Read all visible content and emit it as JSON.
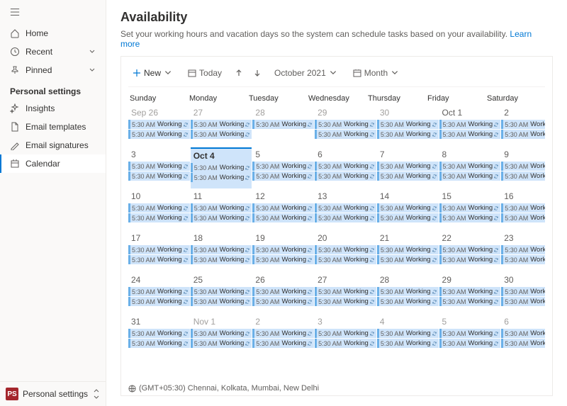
{
  "sidebar": {
    "items": [
      {
        "icon": "home",
        "label": "Home"
      },
      {
        "icon": "clock",
        "label": "Recent",
        "expandable": true
      },
      {
        "icon": "pin",
        "label": "Pinned",
        "expandable": true
      }
    ],
    "section": "Personal settings",
    "settings": [
      {
        "icon": "insights",
        "label": "Insights"
      },
      {
        "icon": "doc",
        "label": "Email templates"
      },
      {
        "icon": "sig",
        "label": "Email signatures"
      },
      {
        "icon": "cal",
        "label": "Calendar",
        "selected": true
      }
    ],
    "footer": {
      "badge": "PS",
      "label": "Personal settings"
    }
  },
  "header": {
    "title": "Availability",
    "desc": "Set your working hours and vacation days so the system can schedule tasks based on your availability.",
    "link": "Learn more"
  },
  "toolbar": {
    "new": "New",
    "today": "Today",
    "period": "October 2021",
    "view": "Month"
  },
  "dayHeaders": [
    "Sunday",
    "Monday",
    "Tuesday",
    "Wednesday",
    "Thursday",
    "Friday",
    "Saturday"
  ],
  "event": {
    "time": "5:30 AM",
    "label": "Working"
  },
  "weeks": [
    [
      {
        "d": "Sep 26",
        "o": true,
        "e": 2
      },
      {
        "d": "27",
        "o": true,
        "e": 2
      },
      {
        "d": "28",
        "o": true,
        "e": 1
      },
      {
        "d": "29",
        "o": true,
        "e": 2
      },
      {
        "d": "30",
        "o": true,
        "e": 2
      },
      {
        "d": "Oct 1",
        "e": 2
      },
      {
        "d": "2",
        "e": 2
      }
    ],
    [
      {
        "d": "3",
        "e": 2
      },
      {
        "d": "Oct 4",
        "today": true,
        "e": 2
      },
      {
        "d": "5",
        "e": 2
      },
      {
        "d": "6",
        "e": 2
      },
      {
        "d": "7",
        "e": 2
      },
      {
        "d": "8",
        "e": 2
      },
      {
        "d": "9",
        "e": 2
      }
    ],
    [
      {
        "d": "10",
        "e": 2
      },
      {
        "d": "11",
        "e": 2
      },
      {
        "d": "12",
        "e": 2
      },
      {
        "d": "13",
        "e": 2
      },
      {
        "d": "14",
        "e": 2
      },
      {
        "d": "15",
        "e": 2
      },
      {
        "d": "16",
        "e": 2
      }
    ],
    [
      {
        "d": "17",
        "e": 2
      },
      {
        "d": "18",
        "e": 2
      },
      {
        "d": "19",
        "e": 2
      },
      {
        "d": "20",
        "e": 2
      },
      {
        "d": "21",
        "e": 2
      },
      {
        "d": "22",
        "e": 2
      },
      {
        "d": "23",
        "e": 2
      }
    ],
    [
      {
        "d": "24",
        "e": 2
      },
      {
        "d": "25",
        "e": 2
      },
      {
        "d": "26",
        "e": 2
      },
      {
        "d": "27",
        "e": 2
      },
      {
        "d": "28",
        "e": 2
      },
      {
        "d": "29",
        "e": 2
      },
      {
        "d": "30",
        "e": 2
      }
    ],
    [
      {
        "d": "31",
        "e": 2
      },
      {
        "d": "Nov 1",
        "o": true,
        "e": 2
      },
      {
        "d": "2",
        "o": true,
        "e": 2
      },
      {
        "d": "3",
        "o": true,
        "e": 2
      },
      {
        "d": "4",
        "o": true,
        "e": 2
      },
      {
        "d": "5",
        "o": true,
        "e": 2
      },
      {
        "d": "6",
        "o": true,
        "e": 2
      }
    ]
  ],
  "timezone": "(GMT+05:30) Chennai, Kolkata, Mumbai, New Delhi"
}
